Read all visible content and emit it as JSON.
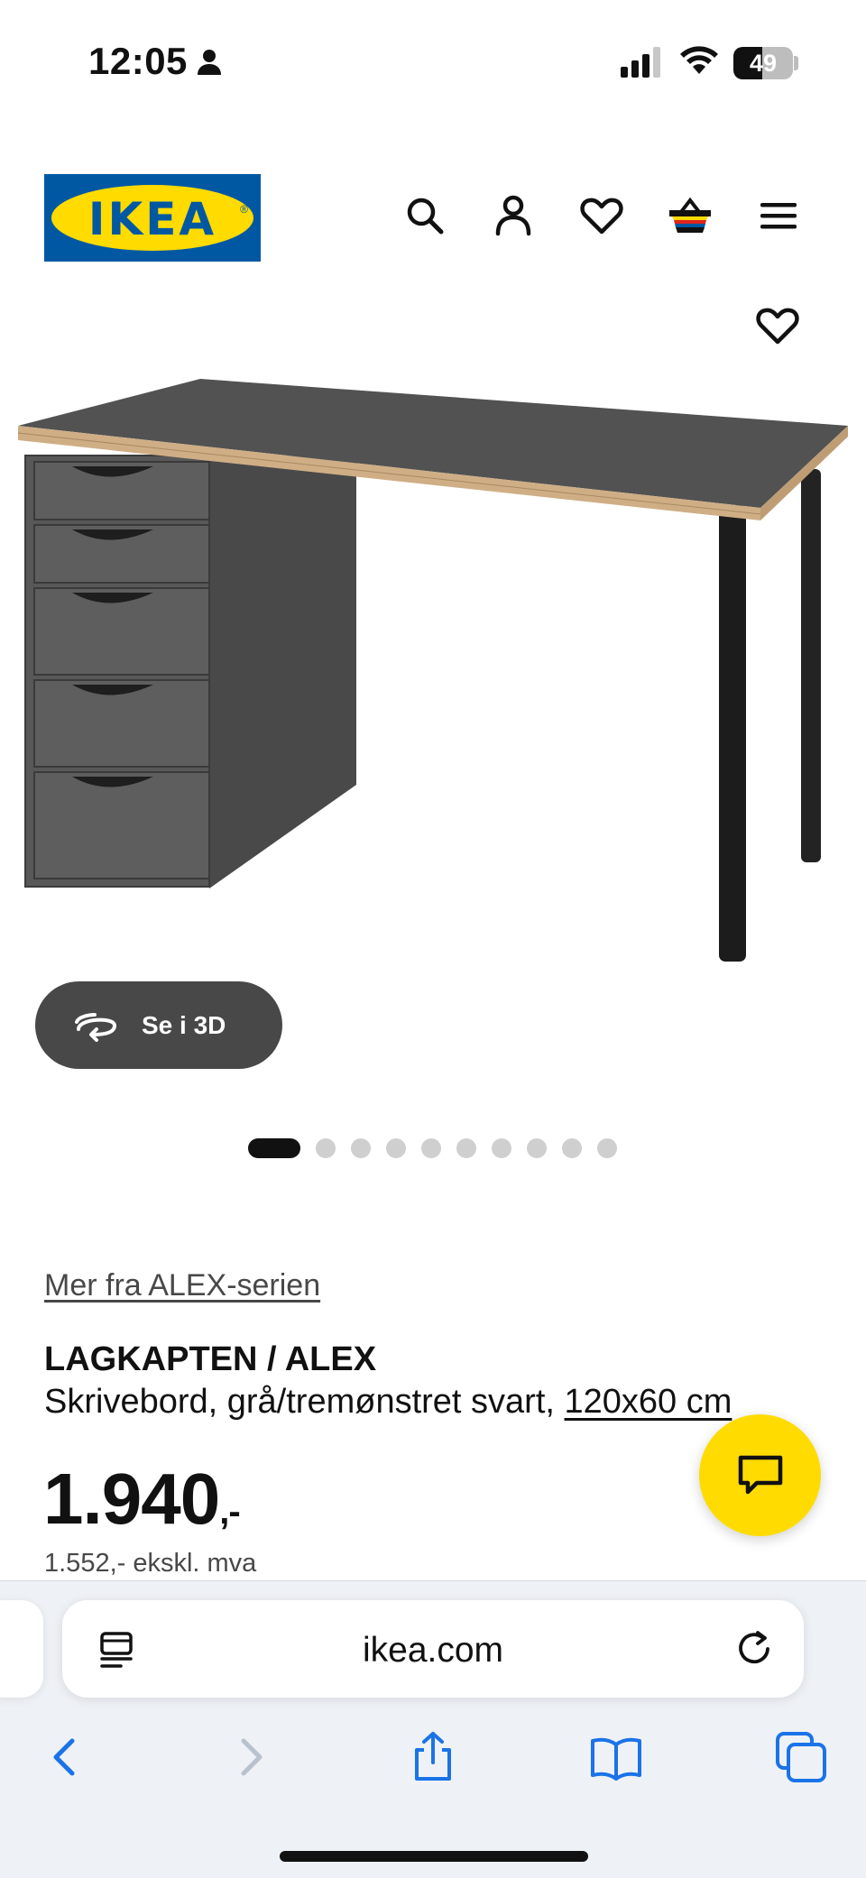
{
  "status_bar": {
    "time": "12:05",
    "battery": "49"
  },
  "header": {
    "logo_text": "IKEA",
    "icons": [
      "search-icon",
      "account-icon",
      "wishlist-icon",
      "basket-icon",
      "menu-icon"
    ]
  },
  "gallery": {
    "view_3d_label": "Se i 3D",
    "total_images": 10,
    "active_index": 0
  },
  "product": {
    "series_link": "Mer fra ALEX-serien",
    "name": "LAGKAPTEN / ALEX",
    "description": "Skrivebord, grå/tremønstret svart, ",
    "size_link": "120x60 cm",
    "price_main": "1.940",
    "price_suffix": ",-",
    "price_ex_vat": "1.552,- ekskl. mva"
  },
  "browser": {
    "url": "ikea.com",
    "toolbar": [
      "back-icon",
      "forward-icon",
      "share-icon",
      "bookmarks-icon",
      "tabs-icon"
    ]
  },
  "colors": {
    "ikea_blue": "#0058a3",
    "ikea_yellow": "#ffdb00",
    "link_blue": "#1a73e8"
  }
}
